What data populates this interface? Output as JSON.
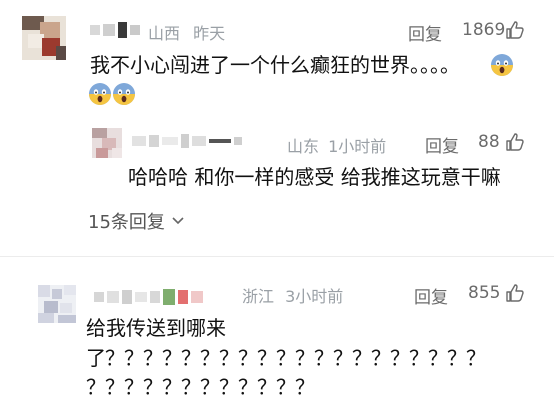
{
  "comments": [
    {
      "location": "山西",
      "time": "昨天",
      "reply_label": "回复",
      "likes": "1869",
      "text": "我不小心闯进了一个什么癫狂的世界。。。。",
      "emojis": [
        "scream-emoji",
        "scream-emoji",
        "scream-emoji"
      ]
    },
    {
      "location": "山东",
      "time": "1小时前",
      "reply_label": "回复",
      "likes": "88",
      "text": "哈哈哈 和你一样的感受 给我推这玩意干嘛"
    },
    {
      "location": "浙江",
      "time": "3小时前",
      "reply_label": "回复",
      "likes": "855",
      "text_line1": "给我传送到哪来",
      "text_line2": "了？？？？？？？？？？？？？？？？？？？？",
      "text_line3": "？？？？？？？？？？？？"
    }
  ],
  "replies_toggle": {
    "label": "15条回复"
  }
}
